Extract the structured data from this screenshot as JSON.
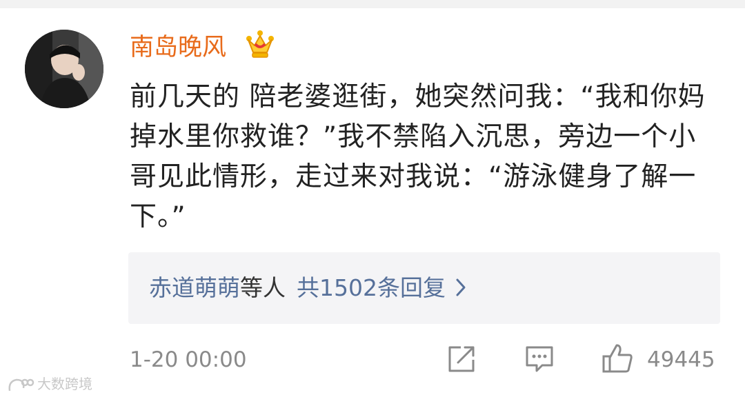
{
  "author": {
    "name": "南岛晚风",
    "badge": "crown-icon"
  },
  "comment": {
    "text": "前几天的  陪老婆逛街，她突然问我：“我和你妈掉水里你救谁？”我不禁陷入沉思，旁边一个小哥见此情形，走过来对我说：“游泳健身了解一下。”"
  },
  "replies": {
    "names": "赤道萌萌",
    "others": "等人",
    "count_label": "共1502条回复"
  },
  "footer": {
    "timestamp": "1-20 00:00",
    "like_count": "49445"
  },
  "watermark": {
    "text": "大数跨境"
  },
  "colors": {
    "username": "#e86b1b",
    "reply_link": "#56709a",
    "meta_text": "#8a8a8a",
    "crown": "#f4b400"
  }
}
